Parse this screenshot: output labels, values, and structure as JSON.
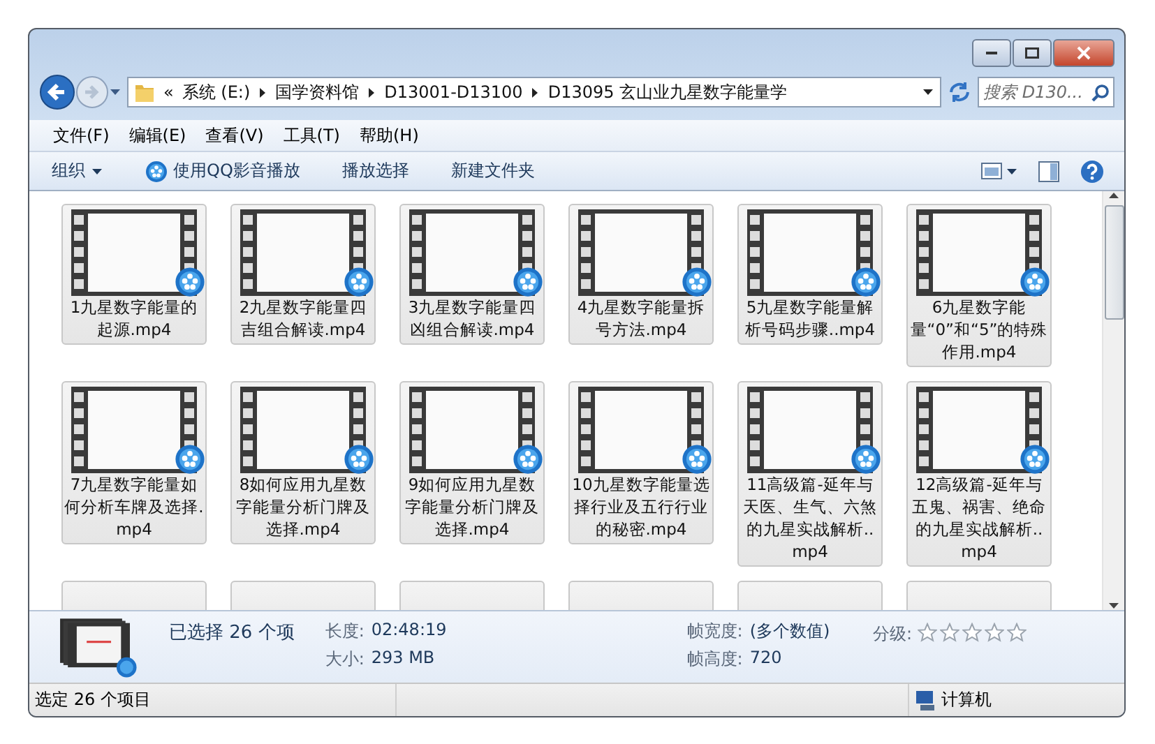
{
  "address_bar": {
    "path": [
      {
        "label": "系统 (E:)"
      },
      {
        "label": "国学资料馆"
      },
      {
        "label": "D13001-D13100"
      },
      {
        "label": "D13095 玄山业九星数字能量学"
      }
    ],
    "overflow": "«"
  },
  "search": {
    "placeholder": "搜索 D130..."
  },
  "menu": [
    "文件(F)",
    "编辑(E)",
    "查看(V)",
    "工具(T)",
    "帮助(H)"
  ],
  "toolbar": [
    {
      "label": "组织",
      "kind": "dropdown"
    },
    {
      "label": "使用QQ影音播放",
      "kind": "app"
    },
    {
      "label": "播放选择",
      "kind": "plain"
    },
    {
      "label": "新建文件夹",
      "kind": "plain"
    }
  ],
  "files": [
    {
      "name": "1九星数字能量的起源.mp4",
      "selected": true
    },
    {
      "name": "2九星数字能量四吉组合解读.mp4",
      "selected": true
    },
    {
      "name": "3九星数字能量四凶组合解读.mp4",
      "selected": true
    },
    {
      "name": "4九星数字能量拆号方法.mp4",
      "selected": true
    },
    {
      "name": "5九星数字能量解析号码步骤..mp4",
      "selected": true
    },
    {
      "name": "6九星数字能量“0”和“5”的特殊作用.mp4",
      "selected": true
    },
    {
      "name": "7九星数字能量如何分析车牌及选择.mp4",
      "selected": true
    },
    {
      "name": "8如何应用九星数字能量分析门牌及选择.mp4",
      "selected": true
    },
    {
      "name": "9如何应用九星数字能量分析门牌及选择.mp4",
      "selected": true
    },
    {
      "name": "10九星数字能量选择行业及五行行业的秘密.mp4",
      "selected": true
    },
    {
      "name": "11高级篇-延年与天医、生气、六煞的九星实战解析..mp4",
      "selected": true
    },
    {
      "name": "12高级篇-延年与五鬼、祸害、绝命的九星实战解析..mp4",
      "selected": true
    },
    {
      "selected": true
    },
    {
      "selected": true
    },
    {
      "selected": true
    },
    {
      "selected": true
    },
    {
      "selected": true
    },
    {
      "selected": true
    }
  ],
  "details": {
    "summary": "已选择 26 个项",
    "fields": [
      {
        "label": "长度:",
        "value": "02:48:19"
      },
      {
        "label": "大小:",
        "value": "293 MB"
      },
      {
        "label": "帧宽度:",
        "value": "(多个数值)"
      },
      {
        "label": "帧高度:",
        "value": "720"
      }
    ],
    "rating": {
      "label": "分级:",
      "stars": 0
    }
  },
  "status_bar": {
    "text": "选定 26 个项目",
    "location": "计算机"
  }
}
